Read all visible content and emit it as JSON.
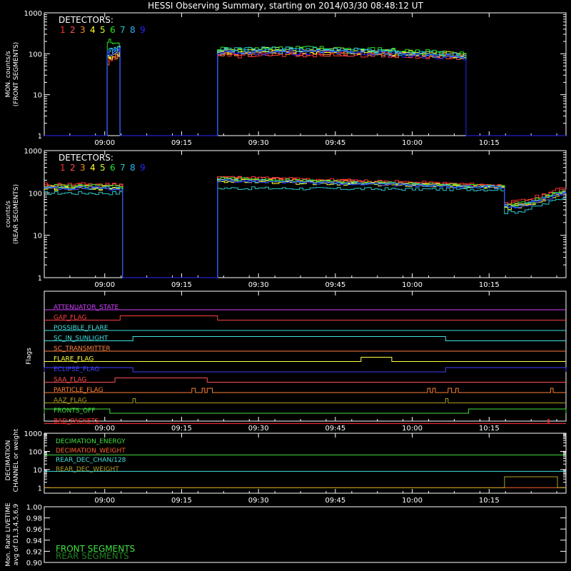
{
  "title": "HESSI Observing Summary, starting on 2014/03/30 08:48:12 UT",
  "colors": {
    "background": "#000000",
    "axis": "#ffffff",
    "detectors": [
      "#ff3030",
      "#ff5050",
      "#ff8c28",
      "#ffff28",
      "#c8ff28",
      "#28e628",
      "#28c8c8",
      "#28b4ff",
      "#2828ff"
    ]
  },
  "time_axis": {
    "start": "08:48:12",
    "end": "10:30:00",
    "ticks": [
      "09:00",
      "09:15",
      "09:30",
      "09:45",
      "10:00",
      "10:15"
    ]
  },
  "chart_data": [
    {
      "type": "line",
      "panel": "front",
      "ylabel": [
        "MON. counts/s",
        "(FRONT SEGMENTS)"
      ],
      "yscale": "log",
      "ylim": [
        1,
        1000
      ],
      "yticks": [
        "1",
        "10",
        "100",
        "1000"
      ],
      "legend_title": "DETECTORS:",
      "legend_entries": [
        "1",
        "2",
        "3",
        "4",
        "5",
        "6",
        "7",
        "8",
        "9"
      ],
      "legend_position": "top-left",
      "intervals": [
        [
          "09:00:30",
          "09:03:00"
        ],
        [
          "09:22:00",
          "10:10:30"
        ]
      ],
      "series": [
        {
          "values": [
            [
              0,
              1
            ],
            [
              60,
              1
            ],
            [
              100,
              8
            ],
            [
              90,
              60
            ],
            [
              80,
              90
            ]
          ]
        },
        {
          "values": [
            [
              0,
              1
            ],
            [
              65,
              1
            ],
            [
              110,
              10
            ],
            [
              95,
              70
            ],
            [
              80,
              95
            ]
          ]
        },
        {
          "values": [
            [
              0,
              1
            ],
            [
              70,
              1
            ],
            [
              105,
              9
            ],
            [
              100,
              75
            ],
            [
              85,
              100
            ]
          ]
        },
        {
          "values": [
            [
              0,
              1
            ],
            [
              80,
              1
            ],
            [
              120,
              12
            ],
            [
              110,
              80
            ],
            [
              90,
              110
            ]
          ]
        },
        {
          "values": [
            [
              0,
              1
            ],
            [
              90,
              1
            ],
            [
              140,
              14
            ],
            [
              120,
              90
            ],
            [
              95,
              115
            ]
          ]
        },
        {
          "values": [
            [
              0,
              1
            ],
            [
              200,
              1
            ],
            [
              160,
              15
            ],
            [
              130,
              95
            ],
            [
              100,
              120
            ]
          ]
        },
        {
          "values": [
            [
              0,
              1
            ],
            [
              120,
              1
            ],
            [
              150,
              11
            ],
            [
              125,
              85
            ],
            [
              90,
              105
            ]
          ]
        },
        {
          "values": [
            [
              0,
              1
            ],
            [
              110,
              1
            ],
            [
              130,
              10
            ],
            [
              115,
              80
            ],
            [
              88,
              100
            ]
          ]
        },
        {
          "values": [
            [
              0,
              1
            ],
            [
              100,
              1
            ],
            [
              125,
              9
            ],
            [
              105,
              75
            ],
            [
              80,
              95
            ]
          ]
        }
      ]
    },
    {
      "type": "line",
      "panel": "rear",
      "ylabel": [
        "counts/s",
        "(REAR SEGMENTS)"
      ],
      "yscale": "log",
      "ylim": [
        1,
        1000
      ],
      "yticks": [
        "1",
        "10",
        "100",
        "1000"
      ],
      "legend_title": "DETECTORS:",
      "legend_entries": [
        "1",
        "2",
        "3",
        "4",
        "5",
        "6",
        "7",
        "8",
        "9"
      ],
      "legend_position": "top-left",
      "series": [
        {
          "values": [
            160,
            240,
            150,
            60
          ]
        },
        {
          "values": [
            150,
            230,
            145,
            55
          ]
        },
        {
          "values": [
            140,
            215,
            140,
            50
          ]
        },
        {
          "values": [
            125,
            190,
            130,
            45
          ]
        },
        {
          "values": [
            135,
            205,
            135,
            48
          ]
        },
        {
          "values": [
            145,
            220,
            140,
            52
          ]
        },
        {
          "values": [
            100,
            130,
            120,
            35
          ]
        },
        {
          "values": [
            130,
            200,
            135,
            48
          ]
        },
        {
          "values": [
            128,
            195,
            132,
            46
          ]
        }
      ]
    },
    {
      "type": "flags",
      "panel": "flags",
      "ylabel": "Flags",
      "flags": [
        {
          "name": "ATTENUATOR_STATE",
          "color": "#d040ff",
          "on": []
        },
        {
          "name": "GAP_FLAG",
          "color": "#ff4040",
          "on": [
            [
              "09:03:00",
              "09:22:00"
            ]
          ]
        },
        {
          "name": "POSSIBLE_FLARE",
          "color": "#40e0e0",
          "on": []
        },
        {
          "name": "SC_IN_SUNLIGHT",
          "color": "#40e0e0",
          "on": [
            [
              "09:05:30",
              "10:06:30"
            ]
          ]
        },
        {
          "name": "SC_TRANSMITTER",
          "color": "#ff8040",
          "on": []
        },
        {
          "name": "FLARE_FLAG",
          "color": "#ffff40",
          "on": [
            [
              "09:50:00",
              "09:56:00"
            ]
          ]
        },
        {
          "name": "ECLIPSE_FLAG",
          "color": "#4040ff",
          "on": [
            [
              "08:48:12",
              "09:05:30"
            ],
            [
              "10:06:30",
              "10:30:00"
            ]
          ]
        },
        {
          "name": "SAA_FLAG",
          "color": "#ff5050",
          "on": [
            [
              "09:02:00",
              "09:20:00"
            ]
          ]
        },
        {
          "name": "PARTICLE_FLAG",
          "color": "#ff8030",
          "on": [
            [
              "09:17:00",
              "09:17:40"
            ],
            [
              "09:19:00",
              "09:19:30"
            ],
            [
              "09:20:00",
              "09:21:00"
            ],
            [
              "10:03:00",
              "10:03:30"
            ],
            [
              "10:04:00",
              "10:04:30"
            ],
            [
              "10:07:00",
              "10:07:40"
            ],
            [
              "10:08:30",
              "10:09:00"
            ],
            [
              "10:27:00",
              "10:27:30"
            ]
          ]
        },
        {
          "name": "AAZ_FLAG",
          "color": "#b0a020",
          "on": [
            [
              "09:05:30",
              "09:06:00"
            ],
            [
              "10:06:30",
              "10:07:00"
            ]
          ]
        },
        {
          "name": "FRONTS_OFF",
          "color": "#40e040",
          "on": [
            [
              "08:48:12",
              "09:01:00"
            ],
            [
              "10:11:00",
              "10:30:00"
            ]
          ]
        },
        {
          "name": "BAD_PACKETS",
          "color": "#ff3030",
          "on": [
            [
              "10:26:30",
              "10:26:40"
            ]
          ]
        }
      ]
    },
    {
      "type": "line",
      "panel": "decimation",
      "ylabel": [
        "DECIMATION",
        "CHANNEL or weight"
      ],
      "yscale": "log",
      "ylim": [
        0.5,
        1000
      ],
      "yticks": [
        "1",
        "10",
        "100",
        "1000"
      ],
      "legend_position": "top-left",
      "series": [
        {
          "name": "DECIMATION_ENERGY",
          "color": "#40e040",
          "values": [
            64
          ]
        },
        {
          "name": "DECIMATION_WEIGHT",
          "color": "#ff6030",
          "values": [
            1
          ]
        },
        {
          "name": "REAR_DEC_CHAN/128",
          "color": "#40e0e0",
          "values": [
            8
          ]
        },
        {
          "name": "REAR_DEC_WEIGHT",
          "color": "#b0a020",
          "values": [
            1
          ]
        }
      ]
    },
    {
      "type": "line",
      "panel": "livetime",
      "ylabel": [
        "Mon. Rate LIVETIME",
        "avg of D1,3,4,5,6,9"
      ],
      "ylim": [
        0.9,
        1.0
      ],
      "yticks": [
        "0.90",
        "0.92",
        "0.94",
        "0.96",
        "0.98",
        "1.00"
      ],
      "legend_position": "bottom-left",
      "series": [
        {
          "name": "FRONT SEGMENTS",
          "color": "#40e040",
          "values": []
        },
        {
          "name": "REAR SEGMENTS",
          "color": "#208020",
          "values": []
        }
      ]
    }
  ]
}
